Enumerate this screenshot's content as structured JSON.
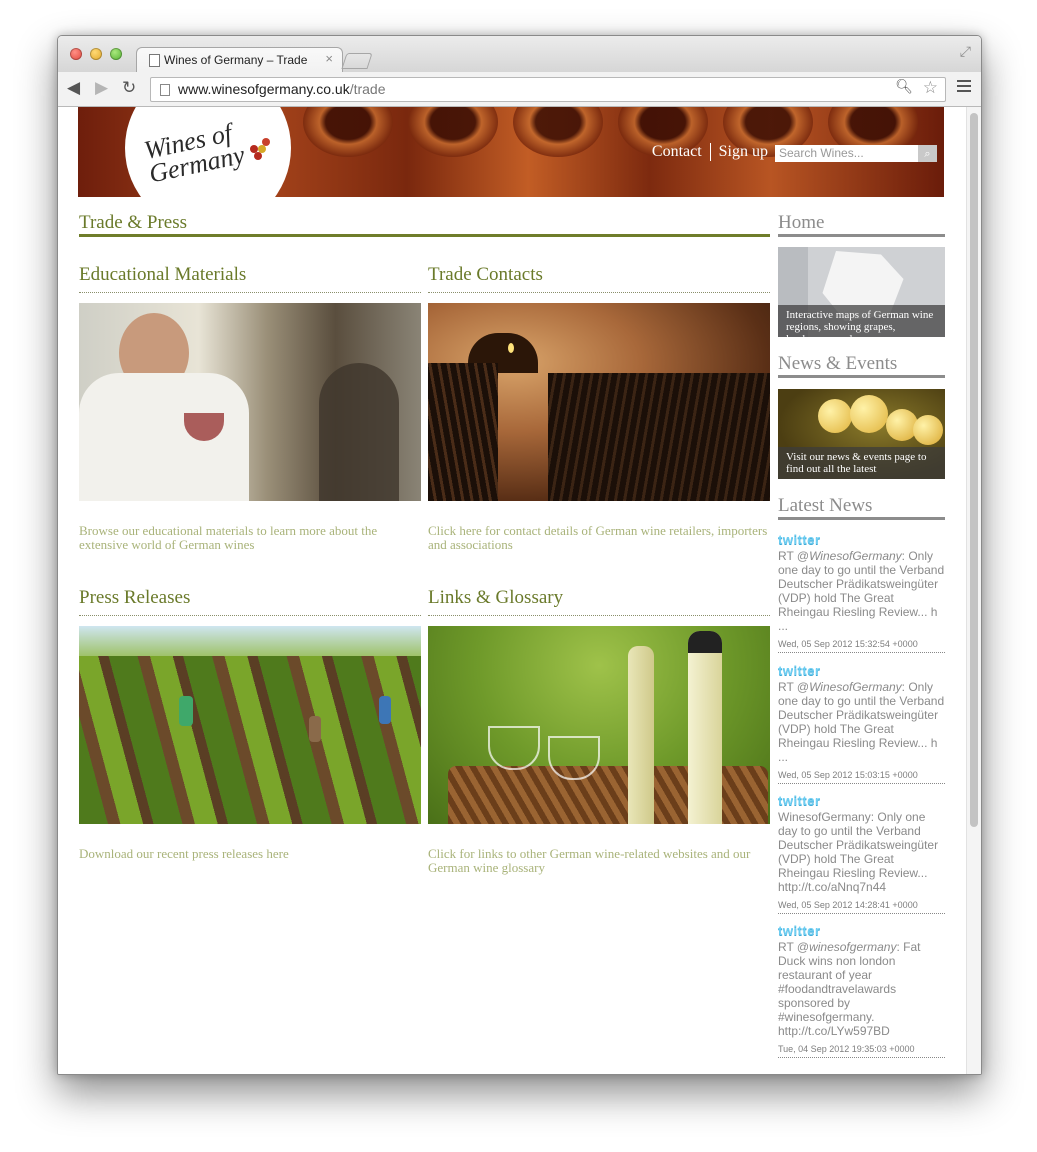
{
  "browser": {
    "tab_title": "Wines of Germany – Trade",
    "tab_close": "×",
    "url_domain": "www.winesofgermany.co.uk",
    "url_path": "/trade"
  },
  "header": {
    "logo_line1": "Wines of",
    "logo_line2": "Germany",
    "nav_contact": "Contact",
    "nav_signup": "Sign up",
    "search_placeholder": "Search Wines..."
  },
  "main": {
    "title": "Trade & Press",
    "sections": [
      {
        "title": "Educational Materials",
        "desc": "Browse our educational materials to learn more about the extensive world of German wines"
      },
      {
        "title": "Trade Contacts",
        "desc": "Click here for contact details of German wine retailers, importers and associations"
      },
      {
        "title": "Press Releases",
        "desc": "Download our recent press releases here"
      },
      {
        "title": "Links & Glossary",
        "desc": "Click for links to other German wine-related websites and our German wine glossary"
      }
    ]
  },
  "sidebar": {
    "home_title": "Home",
    "home_caption": "Interactive maps of German wine regions, showing grapes, landscapes and more",
    "news_title": "News & Events",
    "news_caption": "Visit our news & events page to find out all the latest",
    "latest_title": "Latest News",
    "twitter_label": "twitter",
    "tweets": [
      {
        "prefix": "RT @",
        "handle": "WinesofGermany",
        "text": ": Only one day to go until the Verband Deutscher Prädikatsweingüter (VDP) hold The Great Rheingau Riesling Review... h ...",
        "date": "Wed, 05 Sep 2012 15:32:54 +0000"
      },
      {
        "prefix": "RT @",
        "handle": "WinesofGermany",
        "text": ": Only one day to go until the Verband Deutscher Prädikatsweingüter (VDP) hold The Great Rheingau Riesling Review... h ...",
        "date": "Wed, 05 Sep 2012 15:03:15 +0000"
      },
      {
        "prefix": "",
        "handle": "",
        "text": "WinesofGermany: Only one day to go until the Verband Deutscher Prädikatsweingüter (VDP) hold The Great Rheingau Riesling Review... http://t.co/aNnq7n44",
        "date": "Wed, 05 Sep 2012 14:28:41 +0000"
      },
      {
        "prefix": "RT @",
        "handle": "winesofgermany",
        "text": ": Fat Duck wins non london restaurant of year #foodandtravelawards sponsored by #winesofgermany. http://t.co/LYw597BD",
        "date": "Tue, 04 Sep 2012 19:35:03 +0000"
      }
    ]
  },
  "colors": {
    "accent_green": "#6a7a2a",
    "desc_green": "#a9b37a",
    "sidebar_gray": "#8c8c8c",
    "twitter_blue": "#6fcef2"
  }
}
